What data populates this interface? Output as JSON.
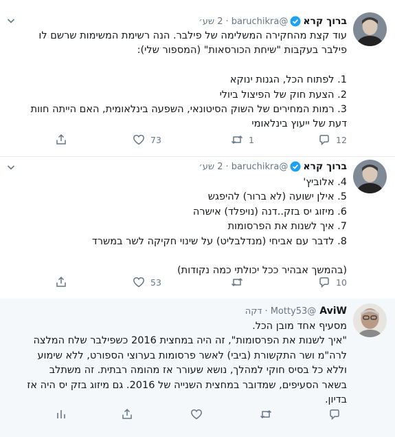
{
  "tweets": [
    {
      "name": "ברוך קרא",
      "handle": "@baruchikra",
      "separator": "·",
      "time": "2 שע׳",
      "lines": [
        "עוד קצת מהחקירה המשלימה של פילבר. הנה רשימת המשימות שרשם לו",
        "פילבר בעקבות \"שיחת הכורסאות\" (המספור שלי):",
        "",
        "1. לפתוח הכל, הגנות ינוקא",
        "2. הצעת חוק של הפיצול ביולי",
        "3. רמות המחירים של השוק הסיטונאי, השפעה בינלאומית, האם הייתה חוות",
        "דעת של ייעוץ בינלאומי"
      ],
      "replies": "12",
      "retweets": "1",
      "likes": "73",
      "icons": {
        "reply": "reply-icon",
        "retweet": "retweet-icon",
        "like": "heart-icon",
        "share": "share-icon"
      }
    },
    {
      "name": "ברוך קרא",
      "handle": "@baruchikra",
      "separator": "·",
      "time": "2 שע׳",
      "lines": [
        "4. אלוביץ'",
        "5. אילן ישועה (לא ברור) להיפגש",
        "6. מיזוג יס בזק..דנה (נויפלד) אישרה",
        "7. איך לשנות את הפרסומות",
        "8. לדבר עם אביחי (מנדלבליט) על שינוי חקיקה לשר במשרד",
        "",
        "(בהמשך אבהיר ככל יכולתי כמה נקודות)"
      ],
      "replies": "10",
      "retweets": "",
      "likes": "53"
    },
    {
      "name": "AviW",
      "handle": "@Motty53",
      "separator": "·",
      "time": "דקה",
      "lines": [
        "מסעיף אחד מובן הכל.",
        "\"איך לשנות את הפרסומות\", זה היה במחצית 2016 כשפילבר שלח המלצה",
        "לרה\"מ ושר התקשורת (ביבי) לאשר פרסומות בערוצי הספורט, ללא שימוע",
        "וללא כל בסיס חוקי למהלך, נושא שעורר אז מהומה רבתית. זה משתלב",
        "בשאר הסעיפים, שמדובר במחצית השנייה של 2016. גם מיזוג בזק יס היה אז",
        "בדיון."
      ],
      "replies": "",
      "retweets": "",
      "likes": ""
    }
  ],
  "colors": {
    "verified": "#1da1f2",
    "text": "#14171a",
    "secondary": "#657786",
    "divider": "#e6ecf0",
    "reply_bg": "#f5f8fa"
  }
}
